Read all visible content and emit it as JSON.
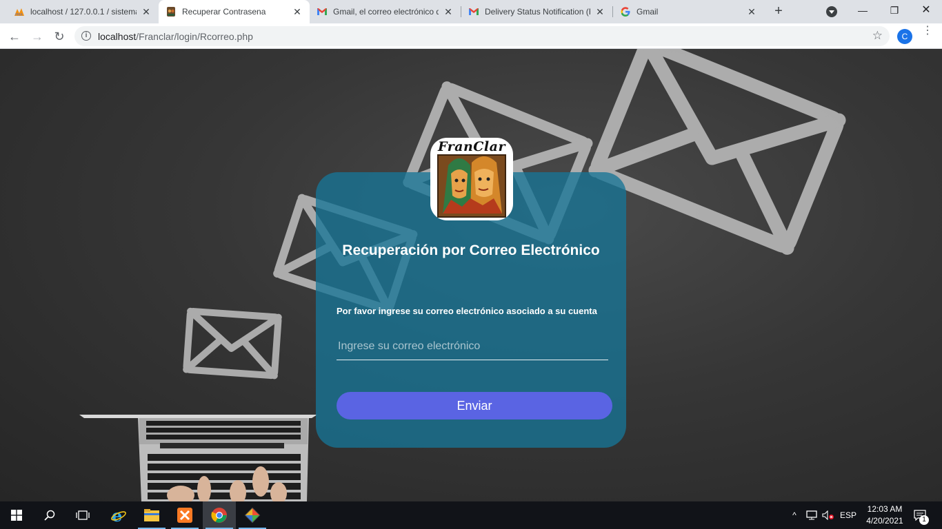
{
  "browser": {
    "tabs": [
      {
        "title": "localhost / 127.0.0.1 / sistema",
        "icon": "phpmyadmin-icon",
        "active": false
      },
      {
        "title": "Recuperar Contrasena",
        "icon": "franclar-favicon",
        "active": true
      },
      {
        "title": "Gmail, el correo electrónico de",
        "icon": "gmail-icon",
        "active": false
      },
      {
        "title": "Delivery Status Notification (F",
        "icon": "gmail-icon",
        "active": false
      },
      {
        "title": "Gmail",
        "icon": "google-icon",
        "active": false
      }
    ],
    "new_tab": "+",
    "url_host": "localhost",
    "url_path": "/Franclar/login/Rcorreo.php",
    "profile_initial": "C"
  },
  "page": {
    "logo_text": "FranClar",
    "title": "Recuperación por Correo Electrónico",
    "subtitle": "Por favor ingrese su correo electrónico asociado a su cuenta",
    "email_placeholder": "Ingrese su correo electrónico",
    "email_value": "",
    "submit_label": "Enviar",
    "colors": {
      "card": "#1774967a",
      "button": "#5a64e3"
    }
  },
  "taskbar": {
    "apps": [
      "windows-start",
      "search",
      "task-view",
      "internet-explorer",
      "file-explorer",
      "xampp",
      "chrome",
      "git"
    ],
    "language": "ESP",
    "time": "12:03 AM",
    "date": "4/20/2021",
    "notification_count": "1"
  }
}
